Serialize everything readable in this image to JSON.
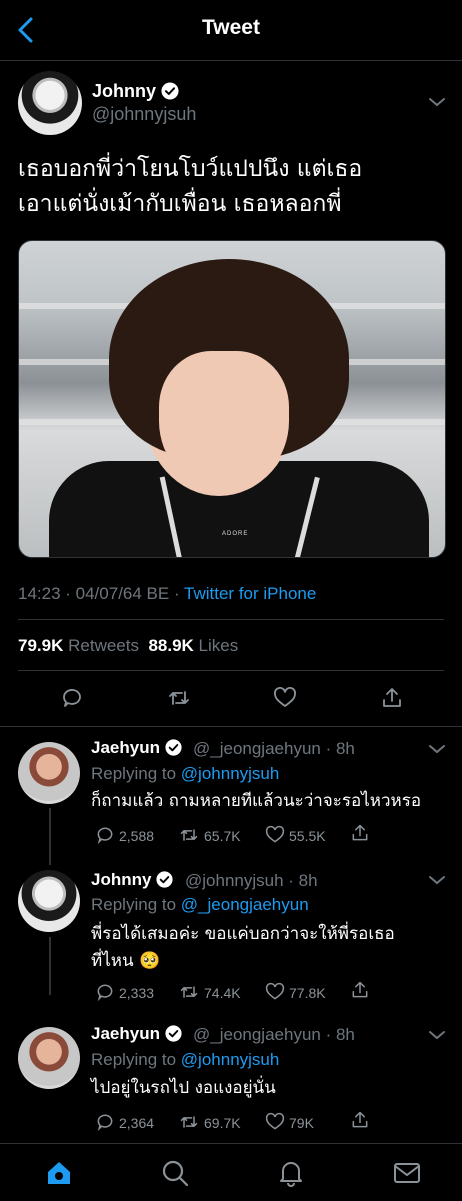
{
  "header": {
    "title": "Tweet"
  },
  "tweet": {
    "name": "Johnny",
    "handle": "@johnnyjsuh",
    "text_line1": "เธอบอกพี่ว่าโยนโบว์แปปนึง แต่เธอ",
    "text_line2": "เอาแต่นั่งเม้ากับเพื่อน เธอหลอกพี่",
    "photo_watermark": "ADORE",
    "time": "14:23 · 04/07/64 BE ·",
    "source": "Twitter for iPhone",
    "retweets": "79.9K",
    "retweets_label": "Retweets",
    "likes": "88.9K",
    "likes_label": "Likes"
  },
  "replies": [
    {
      "name": "Jaehyun",
      "handle_time": "@_jeongjaehyun · 8h",
      "replying_prefix": "Replying to",
      "replying_to": "@johnnyjsuh",
      "text": "ก็ถามแล้ว ถามหลายทีแล้วนะว่าจะรอไหวหรอ",
      "replies": "2,588",
      "retweets": "65.7K",
      "likes": "55.5K"
    },
    {
      "name": "Johnny",
      "handle_time": "@johnnyjsuh · 8h",
      "replying_prefix": "Replying to",
      "replying_to": "@_jeongjaehyun",
      "text_line1": "พี่รอได้เสมอค่ะ ขอแค่บอกว่าจะให้พี่รอเธอ",
      "text_line2": "ที่ไหน 🥺",
      "replies": "2,333",
      "retweets": "74.4K",
      "likes": "77.8K"
    },
    {
      "name": "Jaehyun",
      "handle_time": "@_jeongjaehyun · 8h",
      "replying_prefix": "Replying to",
      "replying_to": "@johnnyjsuh",
      "text": "ไปอยู่ในรถไป งอแงอยู่นั่น",
      "replies": "2,364",
      "retweets": "69.7K",
      "likes": "79K"
    }
  ],
  "icons": {
    "back": "chevron-left-icon",
    "verified": "verified-badge-icon",
    "more": "chevron-down-icon",
    "reply": "reply-icon",
    "retweet": "retweet-icon",
    "like": "heart-icon",
    "share": "share-icon",
    "home": "home-icon",
    "search": "search-icon",
    "notifications": "bell-icon",
    "messages": "mail-icon"
  },
  "colors": {
    "accent": "#1d9bf0",
    "muted": "#6e767d",
    "background": "#000000"
  }
}
